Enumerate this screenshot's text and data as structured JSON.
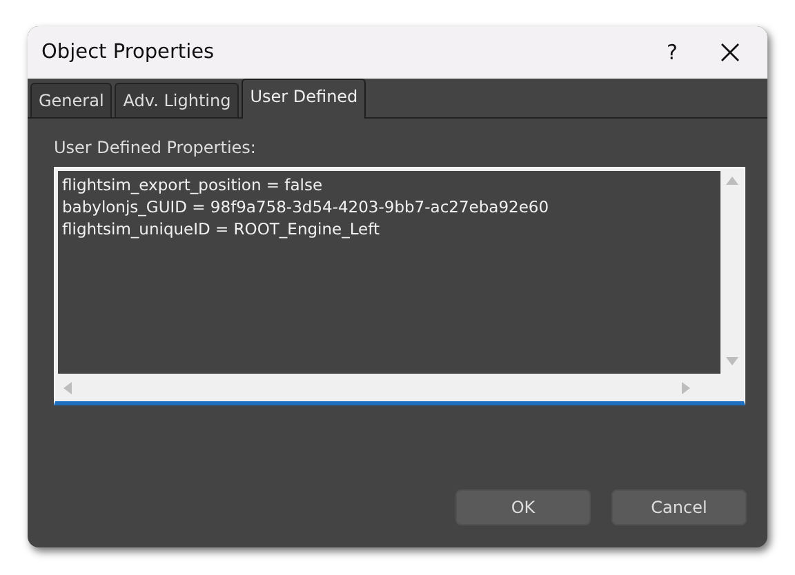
{
  "window": {
    "title": "Object Properties",
    "help": "?"
  },
  "tabs": [
    {
      "label": "General",
      "selected": false
    },
    {
      "label": "Adv. Lighting",
      "selected": false
    },
    {
      "label": "User Defined",
      "selected": true
    }
  ],
  "properties": {
    "label": "User Defined Properties:",
    "lines": [
      "flightsim_export_position = false",
      "babylonjs_GUID = 98f9a758-3d54-4203-9bb7-ac27eba92e60",
      "flightsim_uniqueID = ROOT_Engine_Left"
    ]
  },
  "buttons": [
    "OK",
    "Cancel"
  ]
}
